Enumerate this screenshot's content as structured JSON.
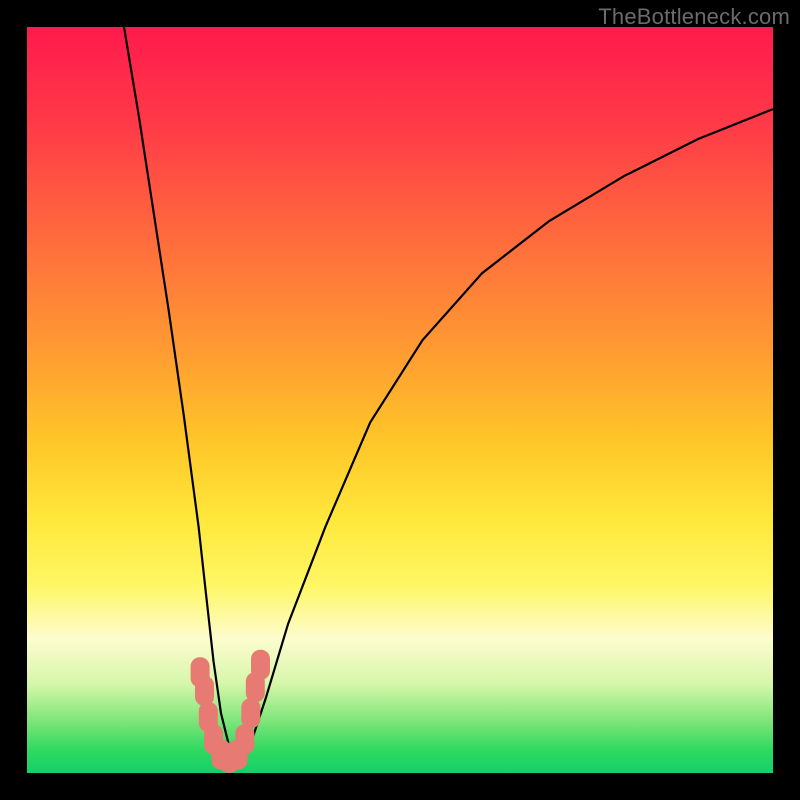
{
  "watermark": "TheBottleneck.com",
  "chart_data": {
    "type": "line",
    "title": "",
    "xlabel": "",
    "ylabel": "",
    "xlim": [
      0,
      100
    ],
    "ylim": [
      0,
      100
    ],
    "grid": false,
    "legend": false,
    "series": [
      {
        "name": "curve",
        "x": [
          13,
          15,
          17,
          19,
          21,
          23,
          24,
          25,
          26,
          27,
          28,
          29,
          30,
          32,
          35,
          40,
          46,
          53,
          61,
          70,
          80,
          90,
          100
        ],
        "y": [
          100,
          88,
          75,
          62,
          48,
          33,
          24,
          15,
          8,
          4,
          2,
          2,
          4,
          10,
          20,
          33,
          47,
          58,
          67,
          74,
          80,
          85,
          89
        ]
      }
    ],
    "markers": {
      "name": "highlight-segment",
      "color": "#e77b73",
      "points": [
        {
          "x": 23.2,
          "y": 13.5
        },
        {
          "x": 23.8,
          "y": 11.0
        },
        {
          "x": 24.3,
          "y": 7.5
        },
        {
          "x": 25.0,
          "y": 4.5
        },
        {
          "x": 26.0,
          "y": 2.5
        },
        {
          "x": 27.1,
          "y": 2.0
        },
        {
          "x": 28.3,
          "y": 2.5
        },
        {
          "x": 29.2,
          "y": 4.5
        },
        {
          "x": 30.0,
          "y": 8.0
        },
        {
          "x": 30.6,
          "y": 11.5
        },
        {
          "x": 31.3,
          "y": 14.5
        }
      ]
    },
    "gradient_stops": [
      {
        "pos": 0,
        "color": "#ff1a4d"
      },
      {
        "pos": 28,
        "color": "#ff6a3d"
      },
      {
        "pos": 55,
        "color": "#ffc428"
      },
      {
        "pos": 75,
        "color": "#fff766"
      },
      {
        "pos": 88,
        "color": "#d6f7aa"
      },
      {
        "pos": 100,
        "color": "#15d06a"
      }
    ]
  }
}
